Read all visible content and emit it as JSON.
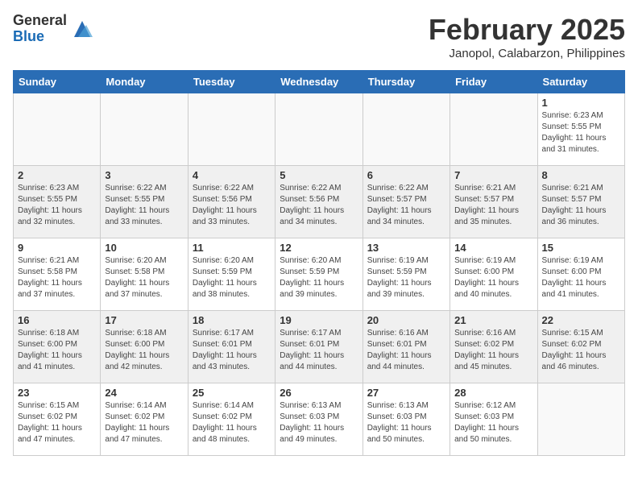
{
  "header": {
    "logo_general": "General",
    "logo_blue": "Blue",
    "month_title": "February 2025",
    "location": "Janopol, Calabarzon, Philippines"
  },
  "weekdays": [
    "Sunday",
    "Monday",
    "Tuesday",
    "Wednesday",
    "Thursday",
    "Friday",
    "Saturday"
  ],
  "weeks": [
    [
      {
        "day": "",
        "info": ""
      },
      {
        "day": "",
        "info": ""
      },
      {
        "day": "",
        "info": ""
      },
      {
        "day": "",
        "info": ""
      },
      {
        "day": "",
        "info": ""
      },
      {
        "day": "",
        "info": ""
      },
      {
        "day": "1",
        "info": "Sunrise: 6:23 AM\nSunset: 5:55 PM\nDaylight: 11 hours\nand 31 minutes."
      }
    ],
    [
      {
        "day": "2",
        "info": "Sunrise: 6:23 AM\nSunset: 5:55 PM\nDaylight: 11 hours\nand 32 minutes."
      },
      {
        "day": "3",
        "info": "Sunrise: 6:22 AM\nSunset: 5:55 PM\nDaylight: 11 hours\nand 33 minutes."
      },
      {
        "day": "4",
        "info": "Sunrise: 6:22 AM\nSunset: 5:56 PM\nDaylight: 11 hours\nand 33 minutes."
      },
      {
        "day": "5",
        "info": "Sunrise: 6:22 AM\nSunset: 5:56 PM\nDaylight: 11 hours\nand 34 minutes."
      },
      {
        "day": "6",
        "info": "Sunrise: 6:22 AM\nSunset: 5:57 PM\nDaylight: 11 hours\nand 34 minutes."
      },
      {
        "day": "7",
        "info": "Sunrise: 6:21 AM\nSunset: 5:57 PM\nDaylight: 11 hours\nand 35 minutes."
      },
      {
        "day": "8",
        "info": "Sunrise: 6:21 AM\nSunset: 5:57 PM\nDaylight: 11 hours\nand 36 minutes."
      }
    ],
    [
      {
        "day": "9",
        "info": "Sunrise: 6:21 AM\nSunset: 5:58 PM\nDaylight: 11 hours\nand 37 minutes."
      },
      {
        "day": "10",
        "info": "Sunrise: 6:20 AM\nSunset: 5:58 PM\nDaylight: 11 hours\nand 37 minutes."
      },
      {
        "day": "11",
        "info": "Sunrise: 6:20 AM\nSunset: 5:59 PM\nDaylight: 11 hours\nand 38 minutes."
      },
      {
        "day": "12",
        "info": "Sunrise: 6:20 AM\nSunset: 5:59 PM\nDaylight: 11 hours\nand 39 minutes."
      },
      {
        "day": "13",
        "info": "Sunrise: 6:19 AM\nSunset: 5:59 PM\nDaylight: 11 hours\nand 39 minutes."
      },
      {
        "day": "14",
        "info": "Sunrise: 6:19 AM\nSunset: 6:00 PM\nDaylight: 11 hours\nand 40 minutes."
      },
      {
        "day": "15",
        "info": "Sunrise: 6:19 AM\nSunset: 6:00 PM\nDaylight: 11 hours\nand 41 minutes."
      }
    ],
    [
      {
        "day": "16",
        "info": "Sunrise: 6:18 AM\nSunset: 6:00 PM\nDaylight: 11 hours\nand 41 minutes."
      },
      {
        "day": "17",
        "info": "Sunrise: 6:18 AM\nSunset: 6:00 PM\nDaylight: 11 hours\nand 42 minutes."
      },
      {
        "day": "18",
        "info": "Sunrise: 6:17 AM\nSunset: 6:01 PM\nDaylight: 11 hours\nand 43 minutes."
      },
      {
        "day": "19",
        "info": "Sunrise: 6:17 AM\nSunset: 6:01 PM\nDaylight: 11 hours\nand 44 minutes."
      },
      {
        "day": "20",
        "info": "Sunrise: 6:16 AM\nSunset: 6:01 PM\nDaylight: 11 hours\nand 44 minutes."
      },
      {
        "day": "21",
        "info": "Sunrise: 6:16 AM\nSunset: 6:02 PM\nDaylight: 11 hours\nand 45 minutes."
      },
      {
        "day": "22",
        "info": "Sunrise: 6:15 AM\nSunset: 6:02 PM\nDaylight: 11 hours\nand 46 minutes."
      }
    ],
    [
      {
        "day": "23",
        "info": "Sunrise: 6:15 AM\nSunset: 6:02 PM\nDaylight: 11 hours\nand 47 minutes."
      },
      {
        "day": "24",
        "info": "Sunrise: 6:14 AM\nSunset: 6:02 PM\nDaylight: 11 hours\nand 47 minutes."
      },
      {
        "day": "25",
        "info": "Sunrise: 6:14 AM\nSunset: 6:02 PM\nDaylight: 11 hours\nand 48 minutes."
      },
      {
        "day": "26",
        "info": "Sunrise: 6:13 AM\nSunset: 6:03 PM\nDaylight: 11 hours\nand 49 minutes."
      },
      {
        "day": "27",
        "info": "Sunrise: 6:13 AM\nSunset: 6:03 PM\nDaylight: 11 hours\nand 50 minutes."
      },
      {
        "day": "28",
        "info": "Sunrise: 6:12 AM\nSunset: 6:03 PM\nDaylight: 11 hours\nand 50 minutes."
      },
      {
        "day": "",
        "info": ""
      }
    ]
  ]
}
